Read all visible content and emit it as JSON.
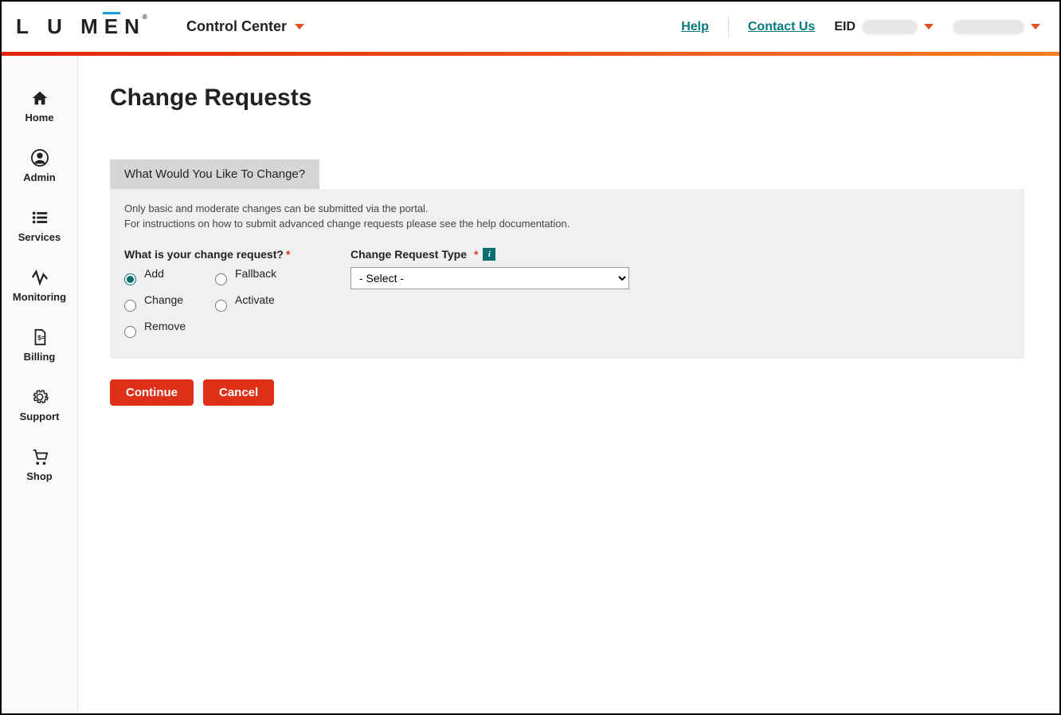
{
  "header": {
    "logo_text": "LUMEN",
    "title": "Control Center",
    "links": {
      "help": "Help",
      "contact": "Contact Us"
    },
    "eid_label": "EID"
  },
  "sidebar": {
    "items": [
      {
        "label": "Home"
      },
      {
        "label": "Admin"
      },
      {
        "label": "Services"
      },
      {
        "label": "Monitoring"
      },
      {
        "label": "Billing"
      },
      {
        "label": "Support"
      },
      {
        "label": "Shop"
      }
    ]
  },
  "main": {
    "page_title": "Change Requests",
    "panel_tab": "What Would You Like To Change?",
    "note_line1": "Only basic and moderate changes can be submitted via the portal.",
    "note_line2": "For instructions on how to submit advanced change requests please see the help documentation.",
    "radio_label": "What is your change request?",
    "radio_options": {
      "add": "Add",
      "fallback": "Fallback",
      "change": "Change",
      "activate": "Activate",
      "remove": "Remove"
    },
    "radio_selected": "add",
    "type_label": "Change Request Type",
    "type_options": [
      "- Select -"
    ],
    "continue_label": "Continue",
    "cancel_label": "Cancel"
  }
}
